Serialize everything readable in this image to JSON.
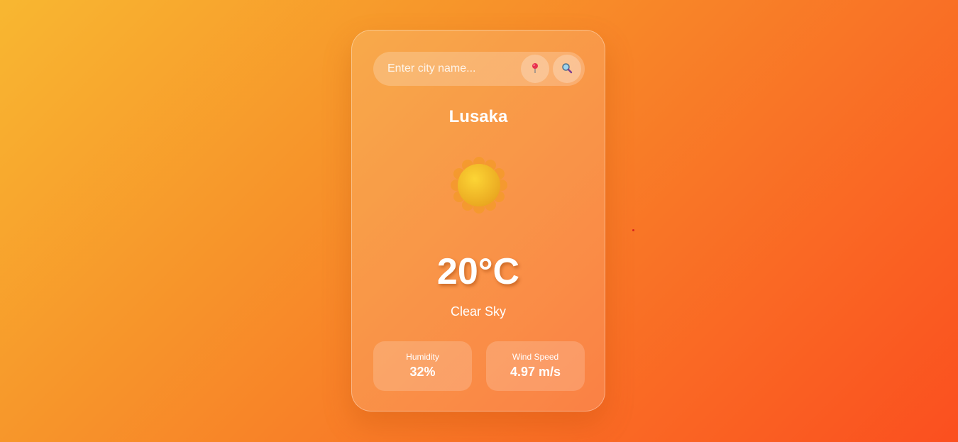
{
  "search": {
    "placeholder": "Enter city name...",
    "value": "",
    "location_icon": "pin-icon",
    "search_icon": "magnifier-icon"
  },
  "weather": {
    "city": "Lusaka",
    "icon": "sun-icon",
    "temperature": "20°C",
    "description": "Clear Sky"
  },
  "stats": {
    "humidity_label": "Humidity",
    "humidity_value": "32%",
    "wind_label": "Wind Speed",
    "wind_value": "4.97 m/s"
  },
  "colors": {
    "background_start": "#f8b731",
    "background_end": "#fb4f1f",
    "text": "#ffffff",
    "sun": "#f6c12c"
  }
}
